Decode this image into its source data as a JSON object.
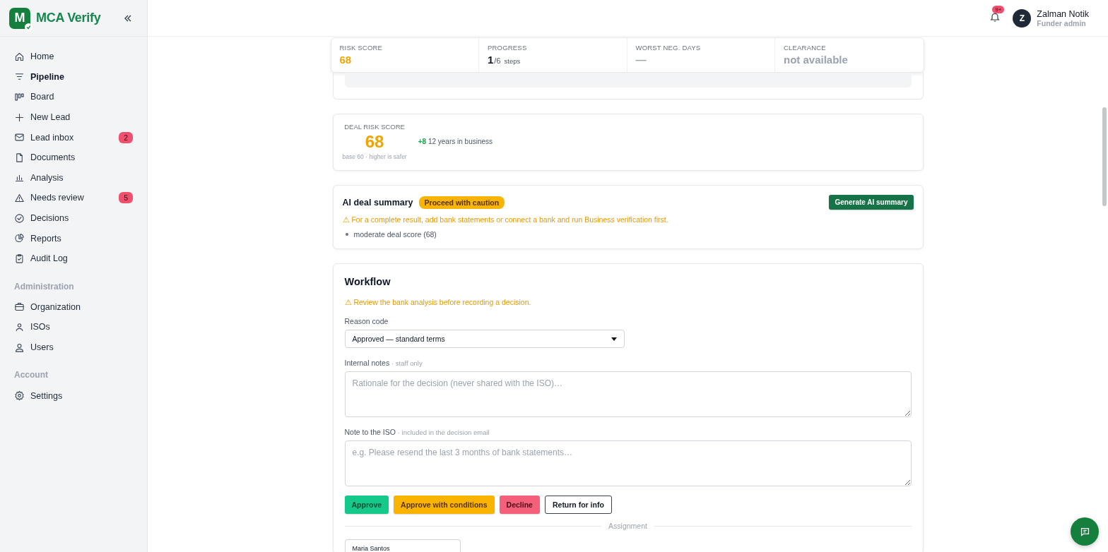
{
  "brand": {
    "logo_letter": "M",
    "name": "MCA Verify"
  },
  "sidebar": {
    "sections": [
      {
        "items": [
          {
            "label": "Home",
            "selected": false
          },
          {
            "label": "Pipeline",
            "selected": true
          },
          {
            "label": "Board",
            "selected": false
          },
          {
            "label": "New Lead",
            "selected": false
          },
          {
            "label": "Lead inbox",
            "selected": false,
            "badge": "2"
          },
          {
            "label": "Documents",
            "selected": false
          },
          {
            "label": "Analysis",
            "selected": false
          },
          {
            "label": "Needs review",
            "selected": false,
            "badge": "5"
          },
          {
            "label": "Decisions",
            "selected": false
          },
          {
            "label": "Reports",
            "selected": false
          },
          {
            "label": "Audit Log",
            "selected": false
          }
        ]
      },
      {
        "title": "Administration",
        "items": [
          {
            "label": "Organization",
            "selected": false
          },
          {
            "label": "ISOs",
            "selected": false
          },
          {
            "label": "Users",
            "selected": false
          }
        ]
      },
      {
        "title": "Account",
        "items": [
          {
            "label": "Settings",
            "selected": false
          }
        ]
      }
    ]
  },
  "header": {
    "notification_count": "9+",
    "user": {
      "initial": "Z",
      "name": "Zalman Notik",
      "role": "Funder admin"
    }
  },
  "stats": [
    {
      "label": "RISK SCORE",
      "value": "68",
      "color": "#f0a500"
    },
    {
      "label": "PROGRESS",
      "value": "1",
      "suffix": "/6",
      "unit": "steps",
      "color": "#111827"
    },
    {
      "label": "WORST NEG. DAYS",
      "value": "—",
      "color": "#9ca3af"
    },
    {
      "label": "CLEARANCE",
      "value": "not available",
      "color": "#9ca3af"
    }
  ],
  "deal_risk": {
    "label": "DEAL RISK SCORE",
    "score": "68",
    "note": "base 60 · higher is safer",
    "factors": [
      {
        "delta": "+8",
        "text": "12 years in business"
      }
    ]
  },
  "ai_summary": {
    "title": "AI deal summary",
    "verdict": "Proceed with caution",
    "button": "Generate AI summary",
    "warning": "⚠ For a complete result, add bank statements or connect a bank and run Business verification first.",
    "bullets": [
      "moderate deal score (68)"
    ]
  },
  "workflow": {
    "title": "Workflow",
    "warning": "⚠ Review the bank analysis before recording a decision.",
    "reason_code": {
      "label": "Reason code",
      "value": "Approved — standard terms"
    },
    "internal_notes": {
      "label": "Internal notes",
      "hint": "· staff only",
      "placeholder": "Rationale for the decision (never shared with the ISO)…"
    },
    "iso_note": {
      "label": "Note to the ISO",
      "hint": "· included in the decision email",
      "placeholder": "e.g. Please resend the last 3 months of bank statements…"
    },
    "actions": [
      {
        "label": "Approve",
        "kind": "approve"
      },
      {
        "label": "Approve with conditions",
        "kind": "conditional"
      },
      {
        "label": "Decline",
        "kind": "decline"
      },
      {
        "label": "Return for info",
        "kind": "return"
      }
    ],
    "assignment": {
      "label": "Assignment",
      "assignee": "Maria Santos"
    }
  }
}
